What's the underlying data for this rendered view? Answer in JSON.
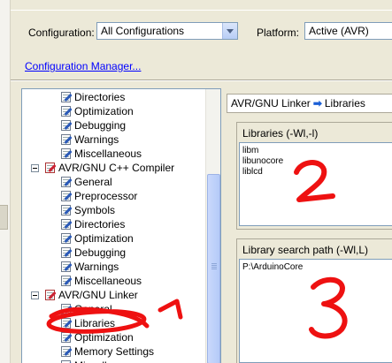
{
  "configuration": {
    "label": "Configuration:",
    "value": "All Configurations"
  },
  "platform": {
    "label": "Platform:",
    "value": "Active (AVR)"
  },
  "configuration_manager": "Configuration Manager...",
  "tree": {
    "items": [
      {
        "label": "Directories",
        "level": 2,
        "icon": "property-page-icon"
      },
      {
        "label": "Optimization",
        "level": 2,
        "icon": "property-page-icon"
      },
      {
        "label": "Debugging",
        "level": 2,
        "icon": "property-page-icon"
      },
      {
        "label": "Warnings",
        "level": 2,
        "icon": "property-page-icon"
      },
      {
        "label": "Miscellaneous",
        "level": 2,
        "icon": "property-page-icon"
      },
      {
        "label": "AVR/GNU C++ Compiler",
        "level": 1,
        "icon": "tool-settings-icon",
        "expanded": true
      },
      {
        "label": "General",
        "level": 2,
        "icon": "property-page-icon"
      },
      {
        "label": "Preprocessor",
        "level": 2,
        "icon": "property-page-icon"
      },
      {
        "label": "Symbols",
        "level": 2,
        "icon": "property-page-icon"
      },
      {
        "label": "Directories",
        "level": 2,
        "icon": "property-page-icon"
      },
      {
        "label": "Optimization",
        "level": 2,
        "icon": "property-page-icon"
      },
      {
        "label": "Debugging",
        "level": 2,
        "icon": "property-page-icon"
      },
      {
        "label": "Warnings",
        "level": 2,
        "icon": "property-page-icon"
      },
      {
        "label": "Miscellaneous",
        "level": 2,
        "icon": "property-page-icon"
      },
      {
        "label": "AVR/GNU Linker",
        "level": 1,
        "icon": "tool-settings-icon",
        "expanded": true
      },
      {
        "label": "General",
        "level": 2,
        "icon": "property-page-icon"
      },
      {
        "label": "Libraries",
        "level": 2,
        "icon": "property-page-icon",
        "selected": true
      },
      {
        "label": "Optimization",
        "level": 2,
        "icon": "property-page-icon"
      },
      {
        "label": "Memory Settings",
        "level": 2,
        "icon": "property-page-icon"
      },
      {
        "label": "Miscellaneous",
        "level": 2,
        "icon": "property-page-icon"
      }
    ]
  },
  "breadcrumb": {
    "parent": "AVR/GNU Linker",
    "current": "Libraries"
  },
  "libraries": {
    "title": "Libraries (-Wl,-l)",
    "items": [
      "libm",
      "libunocore",
      "liblcd"
    ]
  },
  "library_search_path": {
    "title": "Library search path (-Wl,L)",
    "items": [
      "P:\\ArduinoCore"
    ]
  },
  "annotations": {
    "one": "1",
    "two": "2",
    "three": "3",
    "color": "#ee1111"
  }
}
